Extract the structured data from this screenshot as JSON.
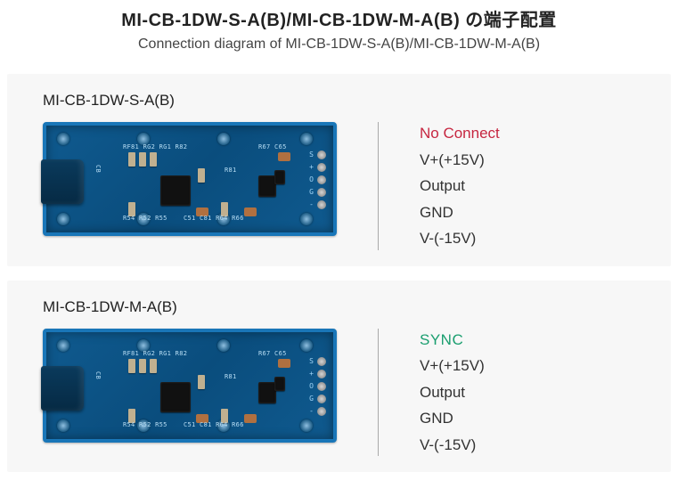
{
  "header": {
    "title": "MI-CB-1DW-S-A(B)/MI-CB-1DW-M-A(B) の端子配置",
    "subtitle": "Connection diagram of MI-CB-1DW-S-A(B)/MI-CB-1DW-M-A(B)"
  },
  "panels": [
    {
      "label": "MI-CB-1DW-S-A(B)",
      "pins": [
        {
          "text": "No Connect",
          "class": "pin-noconnect"
        },
        {
          "text": "V+(+15V)",
          "class": ""
        },
        {
          "text": "Output",
          "class": ""
        },
        {
          "text": "GND",
          "class": ""
        },
        {
          "text": "V-(-15V)",
          "class": ""
        }
      ]
    },
    {
      "label": "MI-CB-1DW-M-A(B)",
      "pins": [
        {
          "text": "SYNC",
          "class": "pin-sync"
        },
        {
          "text": "V+(+15V)",
          "class": ""
        },
        {
          "text": "Output",
          "class": ""
        },
        {
          "text": "GND",
          "class": ""
        },
        {
          "text": "V-(-15V)",
          "class": ""
        }
      ]
    }
  ],
  "pad_labels": [
    "S",
    "+",
    "O",
    "G",
    "-"
  ],
  "silk": {
    "s1": "CB",
    "s2": "RF81 RG2 RG1     R82",
    "s3": "R54 R52    R55",
    "s4": "C51 C81      R64  R66",
    "s5": "R67   C65",
    "s6": "R81"
  }
}
